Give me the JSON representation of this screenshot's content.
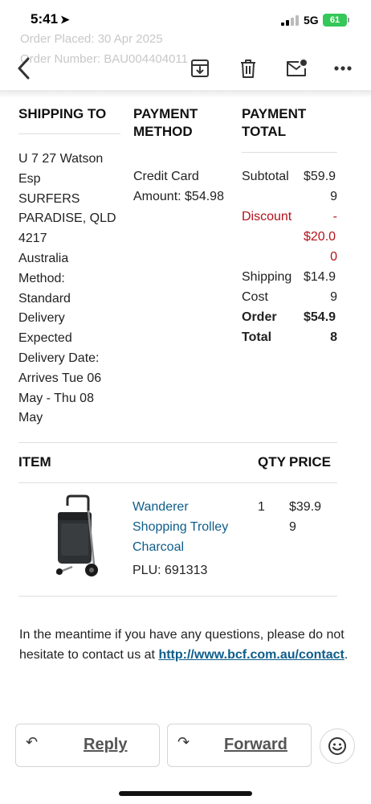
{
  "status_bar": {
    "time": "5:41",
    "network": "5G",
    "battery": "61"
  },
  "header_faded": {
    "order_placed": "Order Placed: 30 Apr 2025",
    "order_number": "Order Number: BAU004404011"
  },
  "toolbar": {
    "back_icon": "chevron-left-icon",
    "archive_icon": "archive-icon",
    "delete_icon": "trash-icon",
    "mark_unread_icon": "mail-unread-icon",
    "more_icon": "more-icon"
  },
  "order": {
    "headers": {
      "shipping": "SHIPPING TO",
      "payment_method": "PAYMENT METHOD",
      "payment_total": "PAYMENT TOTAL"
    },
    "shipping_lines": [
      "U 7 27 Watson",
      "Esp",
      "SURFERS",
      "PARADISE, QLD",
      "4217",
      "Australia",
      "Method:",
      "Standard",
      "Delivery",
      "Expected",
      "Delivery Date:",
      "Arrives Tue 06",
      "May - Thu 08",
      "May"
    ],
    "payment_method": {
      "type": "Credit Card",
      "amount": "Amount: $54.98"
    },
    "totals": {
      "subtotal_label": "Subtotal",
      "subtotal_value_1": "$59.9",
      "subtotal_value_2": "9",
      "discount_label": "Discount",
      "discount_value_1": "-",
      "discount_value_2": "$20.0",
      "discount_value_3": "0",
      "shipping_label_1": "Shipping",
      "shipping_label_2": "Cost",
      "shipping_value_1": "$14.9",
      "shipping_value_2": "9",
      "order_label_1": "Order",
      "order_label_2": "Total",
      "order_value_1": "$54.9",
      "order_value_2": "8"
    }
  },
  "items": {
    "headers": {
      "item": "ITEM",
      "qty": "QTY",
      "price": "PRICE"
    },
    "rows": [
      {
        "name_lines": [
          "Wanderer",
          "Shopping Trolley",
          "Charcoal"
        ],
        "plu": "PLU: 691313",
        "qty": "1",
        "price_1": "$39.9",
        "price_2": "9"
      }
    ]
  },
  "footer": {
    "text_1": "In the meantime if you have any questions, please do not hesitate to contact us",
    "text_at": "at",
    "link": "http://www.bcf.com.au/contact",
    "text_end": "."
  },
  "actions": {
    "reply": "Reply",
    "forward": "Forward"
  },
  "colors": {
    "link": "#0d5d8a",
    "discount": "#b3121b",
    "battery": "#34c759"
  }
}
